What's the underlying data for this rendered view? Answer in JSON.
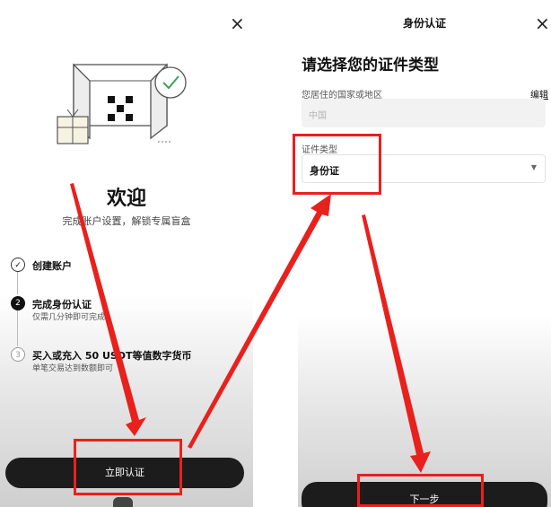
{
  "left": {
    "close": "×",
    "welcome": "欢迎",
    "subtitle": "完成账户设置，解锁专属盲盒",
    "steps": [
      {
        "num": "✓",
        "title": "创建账户",
        "desc": ""
      },
      {
        "num": "2",
        "title": "完成身份认证",
        "desc": "仅需几分钟即可完成"
      },
      {
        "num": "3",
        "title": "买入或充入 50 USDT等值数字货币",
        "desc": "单笔交易达到数额即可"
      }
    ],
    "button": "立即认证"
  },
  "right": {
    "header": "身份认证",
    "close": "×",
    "title": "请选择您的证件类型",
    "country_label": "您居住的国家或地区",
    "edit": "编辑",
    "country_value": "中国",
    "doc_type_label": "证件类型",
    "doc_type_value": "身份证",
    "button": "下一步"
  },
  "colors": {
    "highlight": "#e8211d",
    "button": "#1c1c1c"
  },
  "icons": [
    "close-icon",
    "check-icon",
    "chevron-down-icon",
    "back-icon"
  ]
}
